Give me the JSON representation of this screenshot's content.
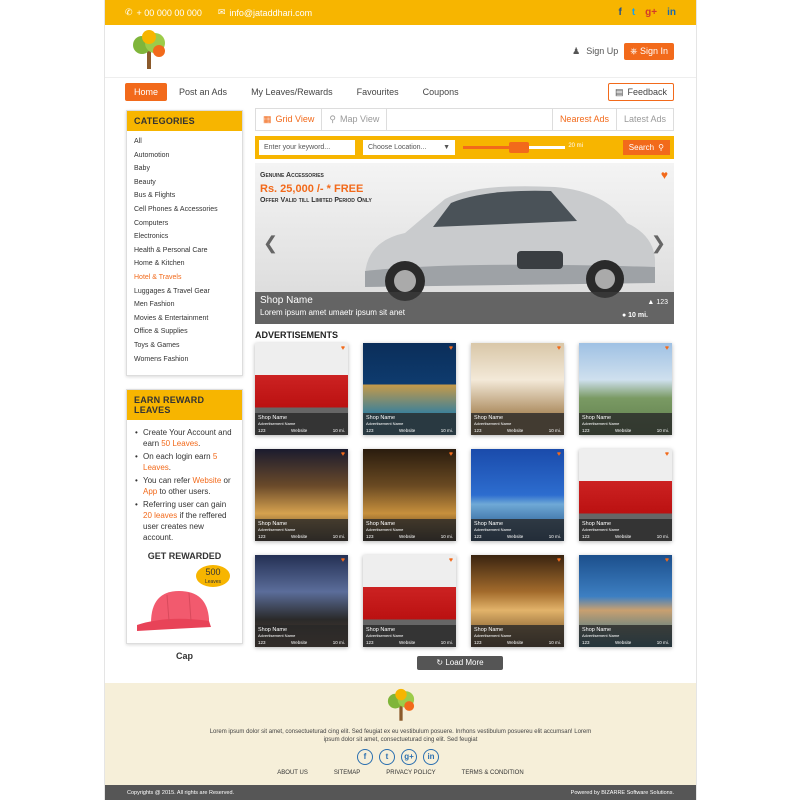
{
  "topbar": {
    "phone": "+ 00 000 00 000",
    "email": "info@jataddhari.com",
    "social": [
      "f",
      "t",
      "g+",
      "in"
    ]
  },
  "header": {
    "signup": "Sign Up",
    "signin": "Sign In"
  },
  "nav": {
    "items": [
      "Home",
      "Post an Ads",
      "My Leaves/Rewards",
      "Favourites",
      "Coupons"
    ],
    "feedback": "Feedback"
  },
  "categories": {
    "title": "CATEGORIES",
    "items": [
      "All",
      "Automotion",
      "Baby",
      "Beauty",
      "Bus & Flights",
      "Cell Phones & Accessories",
      "Computers",
      "Electronics",
      "Health & Personal Care",
      "Home & Kitchen",
      "Hotel & Travels",
      "Luggages & Travel Gear",
      "Men Fashion",
      "Movies & Entertainment",
      "Office & Supplies",
      "Toys & Games",
      "Womens Fashion"
    ],
    "highlighted": "Hotel & Travels"
  },
  "reward": {
    "title": "EARN REWARD LEAVES",
    "b1_a": "Create Your Account and earn ",
    "b1_b": "50 Leaves",
    "b1_c": ".",
    "b2_a": "On each login earn ",
    "b2_b": "5 Leaves",
    "b2_c": ".",
    "b3_a": "You can refer ",
    "b3_b": "Website",
    "b3_c": " or ",
    "b3_d": "App",
    "b3_e": " to other users.",
    "b4_a": "Referring user can gain ",
    "b4_b": "20 leaves",
    "b4_c": " if the reffered user creates new account.",
    "get": "GET REWARDED",
    "badge_num": "500",
    "badge_unit": "Leaves",
    "item": "Cap"
  },
  "tabs": {
    "grid": "Grid View",
    "map": "Map View",
    "nearest": "Nearest Ads",
    "latest": "Latest Ads"
  },
  "search": {
    "keyword_placeholder": "Enter your keyword...",
    "location": "Choose Location...",
    "distance": "20 mi",
    "distance_fraction": 0.55,
    "button": "Search"
  },
  "hero": {
    "small": "Genuine Accessories",
    "price": "Rs. 25,000 /- * FREE",
    "sub": "Offer Valid till Limited Period Only",
    "shop": "Shop Name",
    "desc": "Lorem ipsum amet umaetr ipsum sit anet",
    "likes": "123",
    "distance": "10 mi."
  },
  "ads": {
    "title": "ADVERTISEMENTS",
    "card_name": "Shop Name",
    "card_sub": "Advertisement Name",
    "card_likes": "123",
    "card_web": "Website",
    "card_dist": "10 mi.",
    "themes": [
      "t-car",
      "t-pool",
      "t-bed",
      "t-resort",
      "t-hotel",
      "t-night",
      "t-bluepool",
      "t-car",
      "t-room",
      "t-car",
      "t-lobby",
      "t-dusk"
    ]
  },
  "loadmore": "Load More",
  "footer": {
    "text": "Lorem ipsum dolor sit amet, consectueturad cing elit. Sed feugiat ex eu vestibulum posuere. Inrhons vestibulum posuereu elit accumsan! Lorem ipsum dolor sit amet, consectueturad cing elit. Sed feugiat",
    "social": [
      "f",
      "t",
      "g+",
      "in"
    ],
    "links": [
      "ABOUT US",
      "SITEMAP",
      "PRIVACY POLICY",
      "TERMS & CONDITION"
    ],
    "copyright": "Copyrights @ 2015. All rights are Reserved.",
    "powered": "Powered by BIZARRE Software Solutions."
  },
  "colors": {
    "accent": "#f26a1b",
    "brand": "#f7b500"
  }
}
